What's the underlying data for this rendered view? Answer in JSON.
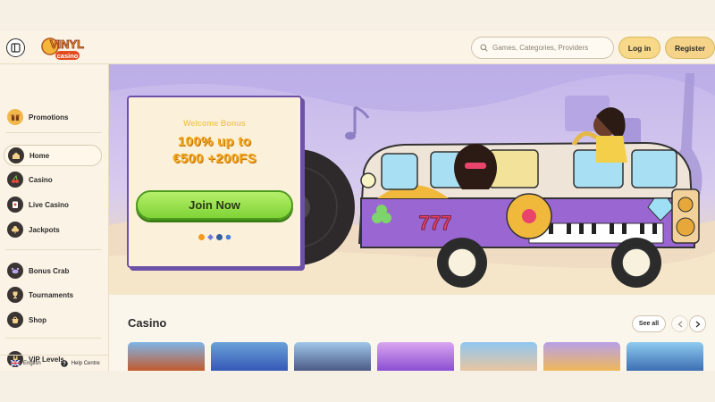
{
  "header": {
    "logo_text_top": "VINYL",
    "logo_text_bottom": "casino",
    "search_placeholder": "Games, Categories, Providers",
    "login_label": "Log in",
    "register_label": "Register"
  },
  "sidebar": {
    "items": [
      {
        "label": "Promotions",
        "icon": "gift-icon"
      },
      {
        "label": "Home",
        "icon": "home-icon"
      },
      {
        "label": "Casino",
        "icon": "cherry-icon"
      },
      {
        "label": "Live Casino",
        "icon": "cards-icon"
      },
      {
        "label": "Jackpots",
        "icon": "clover-icon"
      },
      {
        "label": "Bonus Crab",
        "icon": "crab-icon"
      },
      {
        "label": "Tournaments",
        "icon": "trophy-icon"
      },
      {
        "label": "Shop",
        "icon": "shop-icon"
      },
      {
        "label": "VIP Levels",
        "icon": "rock-hand-icon"
      }
    ],
    "footer": {
      "language": "English",
      "help": "Help Centre"
    }
  },
  "hero": {
    "subtitle": "Welcome Bonus",
    "title_line1": "100% up to",
    "title_line2": "€500 +200FS",
    "cta_label": "Join Now",
    "van_number": "777"
  },
  "casino": {
    "title": "Casino",
    "see_all_label": "See all"
  },
  "colors": {
    "accent_gold": "#f3a91c",
    "cta_green": "#8ad83e",
    "hero_purple": "#c4b6ea",
    "background": "#fbf6ec"
  }
}
